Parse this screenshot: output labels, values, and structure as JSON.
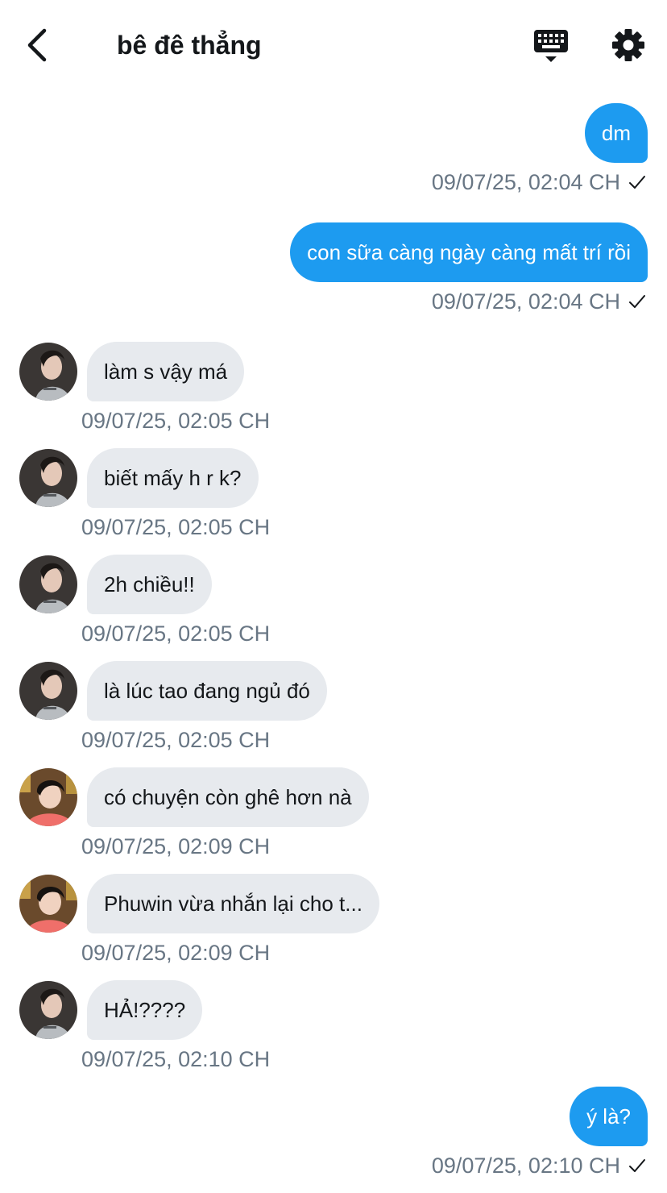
{
  "header": {
    "title": "bê đê thẳng"
  },
  "icons": {
    "back": "chevron-left-icon",
    "keyboard": "keyboard-icon",
    "settings": "gear-icon",
    "read": "checkmark-icon"
  },
  "colors": {
    "outgoing_bubble": "#1d9bf0",
    "incoming_bubble": "#e7eaee",
    "timestamp": "#687684"
  },
  "messages": [
    {
      "dir": "out",
      "text": "dm",
      "time": "09/07/25, 02:04 CH"
    },
    {
      "dir": "out",
      "text": "con sữa càng ngày càng mất trí rồi",
      "time": "09/07/25, 02:04 CH"
    },
    {
      "dir": "in",
      "avatar": "girl",
      "text": "làm s vậy má",
      "time": "09/07/25, 02:05 CH"
    },
    {
      "dir": "in",
      "avatar": "girl",
      "text": "biết mấy h r k?",
      "time": "09/07/25, 02:05 CH"
    },
    {
      "dir": "in",
      "avatar": "girl",
      "text": "2h chiều!!",
      "time": "09/07/25, 02:05 CH"
    },
    {
      "dir": "in",
      "avatar": "girl",
      "text": "là lúc tao đang ngủ đó",
      "time": "09/07/25, 02:05 CH"
    },
    {
      "dir": "in",
      "avatar": "boy",
      "text": "có chuyện còn ghê hơn nà",
      "time": "09/07/25, 02:09 CH"
    },
    {
      "dir": "in",
      "avatar": "boy",
      "text": "Phuwin vừa nhắn lại cho t...",
      "time": "09/07/25, 02:09 CH"
    },
    {
      "dir": "in",
      "avatar": "girl",
      "text": "HẢ!????",
      "time": "09/07/25, 02:10 CH"
    },
    {
      "dir": "out",
      "text": "ý là?",
      "time": "09/07/25, 02:10 CH"
    }
  ]
}
